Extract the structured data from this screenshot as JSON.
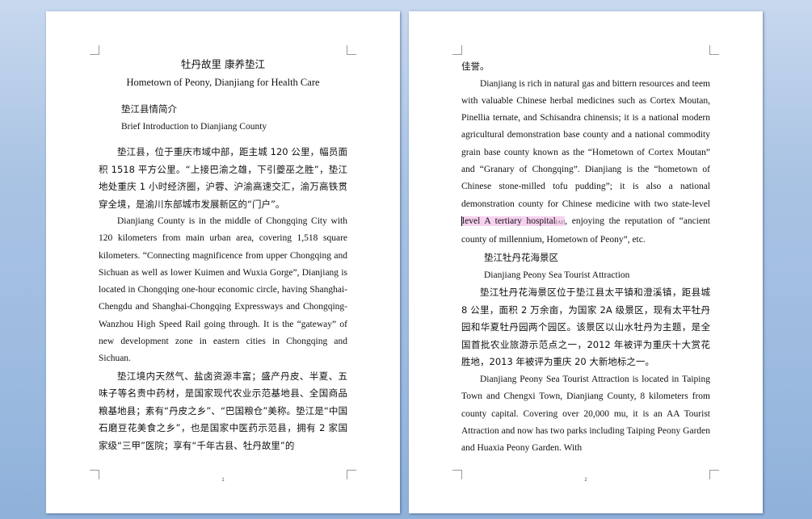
{
  "page1": {
    "title_cn": "牡丹故里 康养垫江",
    "title_en": "Hometown of Peony, Dianjiang for Health Care",
    "subtitle_cn": "垫江县情简介",
    "subtitle_en": "Brief Introduction to Dianjiang County",
    "para1_cn": "垫江县，位于重庆市域中部，距主城 120 公里，幅员面积 1518 平方公里。“上接巴渝之雄，下引夔巫之胜”，垫江地处重庆 1 小时经济圈，沪蓉、沪渝高速交汇，渝万高铁贯穿全境，是渝川东部城市发展新区的“门户”。",
    "para1_en": "Dianjiang County is in the middle of Chongqing City with 120 kilometers from main urban area, covering 1,518 square kilometers. “Connecting magnificence from upper Chongqing and Sichuan as well as lower Kuimen and Wuxia Gorge”, Dianjiang is located in Chongqing one-hour economic circle, having Shanghai-Chengdu and Shanghai-Chongqing Expressways and Chongqing-Wanzhou High Speed Rail going through. It is the “gateway” of new development zone in eastern cities in Chongqing and Sichuan.",
    "para2_cn": "垫江境内天然气、盐卤资源丰富；盛产丹皮、半夏、五味子等名贵中药材，是国家现代农业示范基地县、全国商品粮基地县；素有“丹皮之乡”、“巴国粮仓”美称。垫江是“中国石磨豆花美食之乡”，也是国家中医药示范县，拥有 2 家国家级“三甲”医院；享有“千年古县、牡丹故里”的",
    "page_number": "1"
  },
  "page2": {
    "cont_cn": "佳誉。",
    "para1_en_before": "Dianjiang is rich in natural gas and bittern resources and teem with valuable Chinese herbal medicines such as Cortex Moutan, Pinellia ternate, and Schisandra chinensis; it is a national modern agricultural demonstration base county and a national commodity grain base county known as the “Hometown of Cortex Moutan” and “Granary of Chongqing”. Dianjiang is the “hometown of Chinese stone-milled tofu pudding”; it is also a national demonstration county for Chinese medicine with two state-level ",
    "highlight_text": "level A tertiary hospital",
    "comment_ref": "[A1]",
    "para1_en_after": ", enjoying the reputation of “ancient county of millennium, Hometown of Peony”, etc.",
    "subtitle_cn": "垫江牡丹花海景区",
    "subtitle_en": "Dianjiang Peony Sea Tourist Attraction",
    "para2_cn": "垫江牡丹花海景区位于垫江县太平镇和澄溪镇，距县城 8 公里，面积 2 万余亩，为国家 2A 级景区，现有太平牡丹园和华夏牡丹园两个园区。该景区以山水牡丹为主题，是全国首批农业旅游示范点之一，2012 年被评为重庆十大赏花胜地，2013 年被评为重庆 20 大新地标之一。",
    "para2_en": "Dianjiang Peony Sea Tourist Attraction is located in Taiping Town and Chengxi Town, Dianjiang County, 8 kilometers from county capital. Covering over 20,000 mu, it is an AA Tourist Attraction and now has two parks including Taiping Peony Garden and Huaxia Peony Garden. With",
    "page_number": "2"
  }
}
